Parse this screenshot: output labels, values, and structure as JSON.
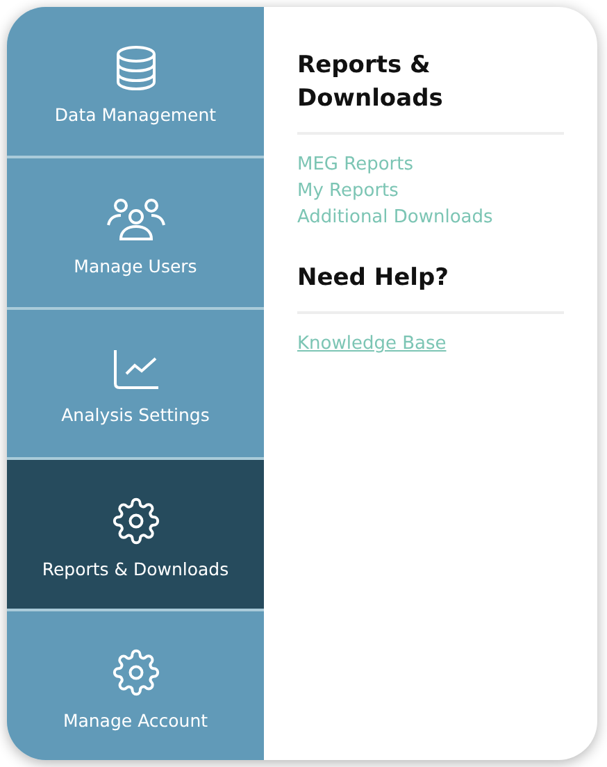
{
  "sidebar": {
    "items": [
      {
        "label": "Data Management",
        "kind": "database",
        "selected": false
      },
      {
        "label": "Manage Users",
        "kind": "users",
        "selected": false
      },
      {
        "label": "Analysis Settings",
        "kind": "chart",
        "selected": false
      },
      {
        "label": "Reports & Downloads",
        "kind": "gear",
        "selected": true
      },
      {
        "label": "Manage Account",
        "kind": "gear",
        "selected": false
      }
    ]
  },
  "panel": {
    "sections": [
      {
        "title": "Reports & Downloads",
        "links": [
          {
            "label": "MEG Reports",
            "underlined": false
          },
          {
            "label": "My Reports",
            "underlined": false
          },
          {
            "label": "Additional Downloads",
            "underlined": false
          }
        ]
      },
      {
        "title": "Need Help?",
        "links": [
          {
            "label": "Knowledge Base",
            "underlined": true
          }
        ]
      }
    ]
  }
}
